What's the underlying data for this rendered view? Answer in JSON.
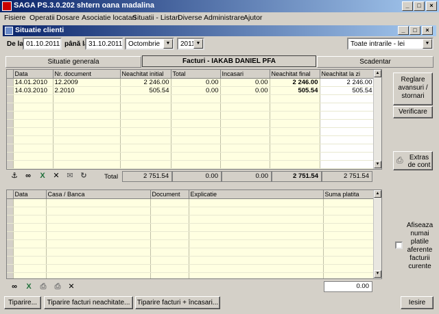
{
  "app": {
    "title": "SAGA PS.3.0.202    shtern oana madalina"
  },
  "menu": [
    "Fisiere",
    "Operatii",
    "Dosare",
    "Asociatie locatari",
    "Situatii - Listari",
    "Diverse",
    "Administrare",
    "Ajutor"
  ],
  "window": {
    "title": "Situatie clienti"
  },
  "filters": {
    "from_label": "De la",
    "from_value": "01.10.2011",
    "to_label": "până la",
    "to_value": "31.10.2011",
    "month": "Octombrie",
    "year": "2011",
    "type": "Toate intrarile - lei"
  },
  "tabs": {
    "general": "Situatie generala",
    "invoices": "Facturi - IAKAB DANIEL PFA",
    "due": "Scadentar"
  },
  "top_grid": {
    "headers": [
      "Data",
      "Nr. document",
      "Neachitat initial",
      "Total",
      "Incasari",
      "Neachitat final",
      "Neachitat la zi"
    ],
    "rows": [
      [
        "14.01.2010",
        "12.2009",
        "2 246.00",
        "0.00",
        "0.00",
        "2 246.00",
        "2 246.00"
      ],
      [
        "14.03.2010",
        "2.2010",
        "505.54",
        "0.00",
        "0.00",
        "505.54",
        "505.54"
      ]
    ],
    "total_label": "Total",
    "totals": [
      "2 751.54",
      "0.00",
      "0.00",
      "2 751.54",
      "2 751.54"
    ]
  },
  "bottom_grid": {
    "headers": [
      "Data",
      "Casa / Banca",
      "Document",
      "Explicatie",
      "Suma platita"
    ],
    "total": "0.00"
  },
  "side": {
    "reglare": "Reglare avansuri / stornari",
    "verificare": "Verificare",
    "extras": "Extras de cont",
    "checkbox_label": "Afiseaza numai platile aferente facturii curente"
  },
  "footer": {
    "print": "Tiparire...",
    "print_unpaid": "Tiparire facturi neachitate...",
    "print_invoices_payments": "Tiparire facturi + încasari...",
    "exit": "Iesire"
  },
  "icons": {
    "top_toolbar": [
      "anchor-icon",
      "binoculars-icon",
      "excel-icon",
      "delete-icon",
      "email-icon",
      "refresh-icon"
    ],
    "bottom_toolbar": [
      "binoculars-icon",
      "excel-icon",
      "print-icon",
      "print-preview-icon",
      "delete-icon"
    ]
  }
}
